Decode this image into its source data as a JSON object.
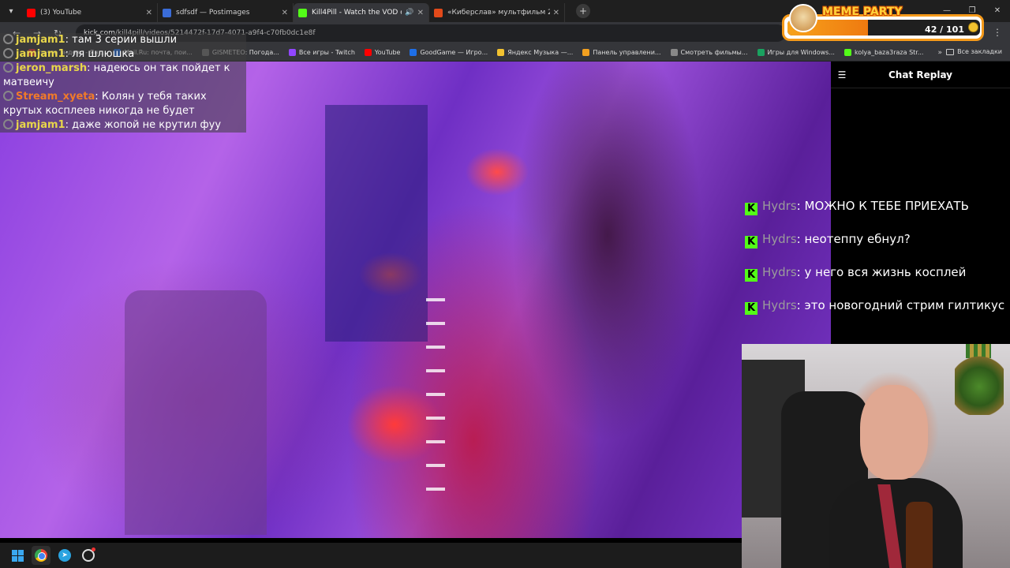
{
  "browser": {
    "tabs": [
      {
        "title": "(3) YouTube",
        "color": "#ff0000",
        "active": false
      },
      {
        "title": "sdfsdf — Postimages",
        "color": "#3a6cd8",
        "active": false
      },
      {
        "title": "Kill4Pill - Watch the VOD o",
        "color": "#53fc18",
        "active": true
      },
      {
        "title": "«Киберслав» мультфильм 202",
        "color": "#e24a1a",
        "active": false
      }
    ],
    "url_host": "kick.com",
    "url_path": "/kill4pill/videos/5214472f-17d7-4071-a9f4-c70fb0dc1e8f",
    "bookmarks": [
      {
        "label": "почта яндекс - Ян...",
        "color": "#e33"
      },
      {
        "label": "Mail.Ru: почта, пои...",
        "color": "#1e6fe8"
      },
      {
        "label": "GISMETEO: Погода...",
        "color": "#777"
      },
      {
        "label": "Все игры - Twitch",
        "color": "#9146ff"
      },
      {
        "label": "YouTube",
        "color": "#ff0000"
      },
      {
        "label": "GoodGame — Игро...",
        "color": "#1e6fe8"
      },
      {
        "label": "Яндекс Музыка —...",
        "color": "#f2c230"
      },
      {
        "label": "Панель управлени...",
        "color": "#f2a020"
      },
      {
        "label": "Смотреть фильмы...",
        "color": "#888"
      },
      {
        "label": "Игры для Windows...",
        "color": "#1aa260"
      },
      {
        "label": "kolya_baza3raza Str...",
        "color": "#53fc18"
      }
    ],
    "all_bookmarks": "Все закладки"
  },
  "overlay_chat": [
    {
      "user": "jamjam1",
      "user_color": "#e8d64a",
      "text": "там 3 серии вышли"
    },
    {
      "user": "jamjam1",
      "user_color": "#e8d64a",
      "text": "ля шлюшка"
    },
    {
      "user": "jeron_marsh",
      "user_color": "#e8d64a",
      "text": "надеюсь он так пойдет к матвеичу"
    },
    {
      "user": "Stream_xyeta",
      "user_color": "#f07a2a",
      "text": "Колян у тебя таких крутых косплеев никогда не будет"
    },
    {
      "user": "jamjam1",
      "user_color": "#e8d64a",
      "text": "даже жопой не крутил фуу"
    }
  ],
  "panel": {
    "title": "Chat Replay"
  },
  "replay_chat": [
    {
      "user": "Hydrs",
      "text": "МОЖНО К ТЕБЕ ПРИЕХАТЬ"
    },
    {
      "user": "Hydrs",
      "text": "неотеппу ебнул?"
    },
    {
      "user": "Hydrs",
      "text": "у него вся жизнь косплей"
    },
    {
      "user": "Hydrs",
      "text": "это новогодний стрим гилтикус"
    }
  ],
  "meme_party": {
    "title": "MEME PARTY",
    "count": "42 / 101",
    "progress": 0.416
  },
  "colors": {
    "kick_green": "#53fc18",
    "accent_orange": "#f59a1a"
  }
}
